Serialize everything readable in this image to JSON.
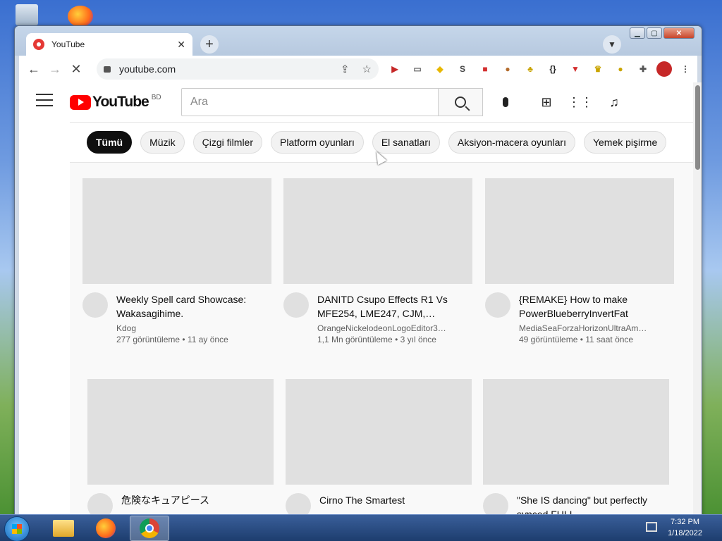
{
  "browser": {
    "tab_title": "YouTube",
    "tab_close": "✕",
    "new_tab": "+",
    "url": "youtube.com",
    "colors": {
      "tab_bg": "#ffffff",
      "toolbar_bg": "#ffffff"
    }
  },
  "youtube": {
    "logo_text": "YouTube",
    "country_code": "BD",
    "search_placeholder": "Ara",
    "chips": [
      "Tümü",
      "Müzik",
      "Çizgi filmler",
      "Platform oyunları",
      "El sanatları",
      "Aksiyon-macera oyunları",
      "Yemek pişirme"
    ],
    "videos": [
      {
        "title": "Weekly Spell card Showcase: Wakasagihime.",
        "channel": "Kdog",
        "stats": "277 görüntüleme • 11 ay önce"
      },
      {
        "title": "DANITD Csupo Effects R1 Vs MFE254, LME247, CJM,…",
        "channel": "OrangeNickelodeonLogoEditor3…",
        "stats": "1,1 Mn görüntüleme • 3 yıl önce"
      },
      {
        "title": "{REMAKE} How to make PowerBlueberryInvertFat",
        "channel": "MediaSeaForzaHorizonUltraAm…",
        "stats": "49 görüntüleme • 11 saat önce"
      },
      {
        "title": "危険なキュアピース",
        "channel": "",
        "stats": ""
      },
      {
        "title": "Cirno The Smartest",
        "channel": "",
        "stats": ""
      },
      {
        "title": "\"She IS dancing\" but perfectly synced FULL",
        "channel": "",
        "stats": ""
      }
    ]
  },
  "taskbar": {
    "time": "7:32 PM",
    "date": "1/18/2022"
  }
}
